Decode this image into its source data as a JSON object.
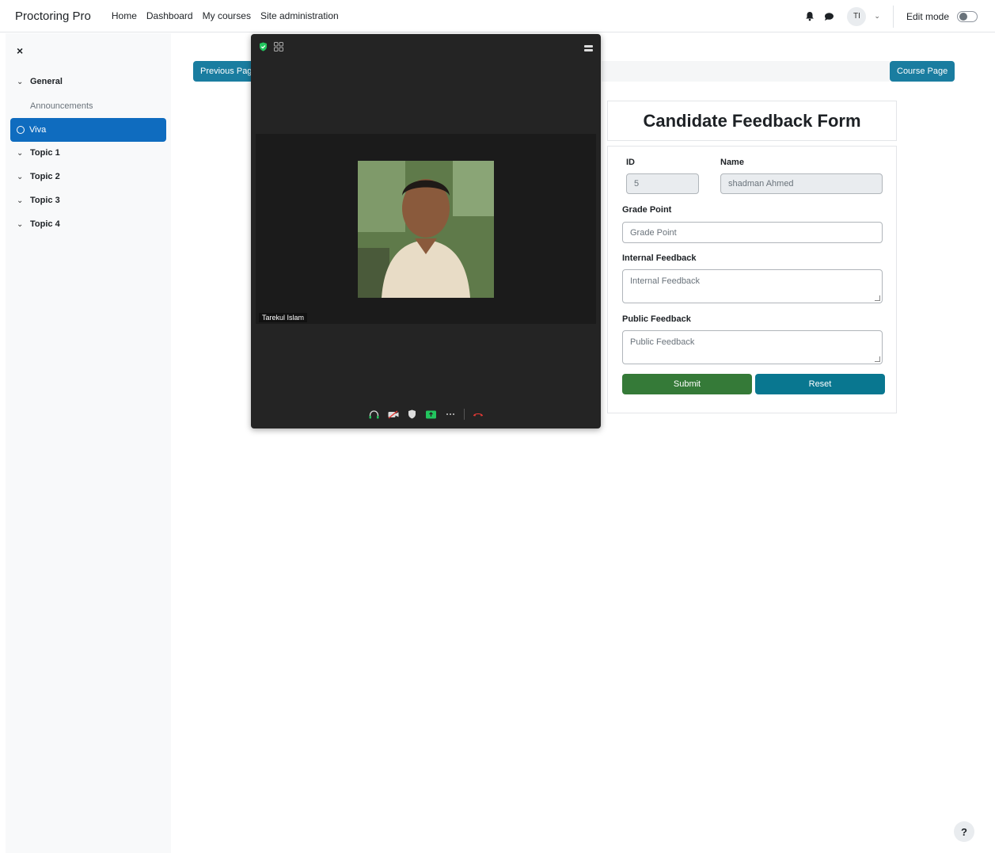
{
  "navbar": {
    "brand": "Proctoring Pro",
    "links": [
      "Home",
      "Dashboard",
      "My courses",
      "Site administration"
    ],
    "avatar_initials": "TI",
    "edit_mode_label": "Edit mode"
  },
  "drawer": {
    "close_icon": "×",
    "items": [
      {
        "label": "General",
        "type": "section"
      },
      {
        "label": "Announcements",
        "type": "sub"
      },
      {
        "label": "Viva",
        "type": "active"
      },
      {
        "label": "Topic 1",
        "type": "section"
      },
      {
        "label": "Topic 2",
        "type": "section"
      },
      {
        "label": "Topic 3",
        "type": "section"
      },
      {
        "label": "Topic 4",
        "type": "section"
      }
    ]
  },
  "page": {
    "previous_button": "Previous Page",
    "course_button": "Course Page"
  },
  "form": {
    "title": "Candidate Feedback Form",
    "id_label": "ID",
    "id_value": "5",
    "name_label": "Name",
    "name_value": "shadman Ahmed",
    "grade_label": "Grade Point",
    "grade_placeholder": "Grade Point",
    "internal_label": "Internal Feedback",
    "internal_placeholder": "Internal Feedback",
    "public_label": "Public Feedback",
    "public_placeholder": "Public Feedback",
    "submit_label": "Submit",
    "reset_label": "Reset"
  },
  "video": {
    "participant_name": "Tarekul Islam"
  },
  "help_label": "?",
  "colors": {
    "primary": "#0f6cbf",
    "teal": "#1a7da0",
    "submit_green": "#357a38",
    "video_bg": "#242424"
  }
}
